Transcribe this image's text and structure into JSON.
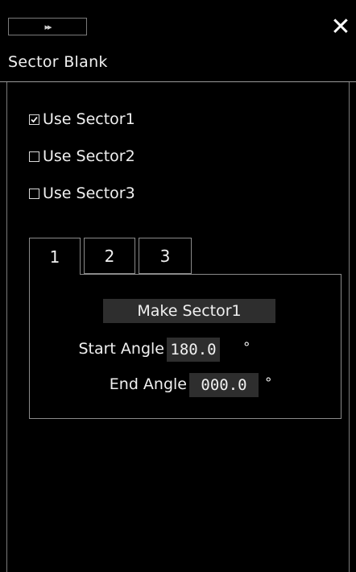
{
  "titlebar": {
    "expand_glyph": "▸▸",
    "close_glyph": "✕"
  },
  "header": {
    "title": "Sector Blank"
  },
  "sectors": [
    {
      "label": "Use Sector1",
      "checked": true
    },
    {
      "label": "Use Sector2",
      "checked": false
    },
    {
      "label": "Use Sector3",
      "checked": false
    }
  ],
  "tabs": [
    {
      "label": "1"
    },
    {
      "label": "2"
    },
    {
      "label": "3"
    }
  ],
  "panel": {
    "make_button": "Make Sector1",
    "start_label": "Start Angle",
    "start_value": "180.0",
    "end_label": "End Angle",
    "end_value": "000.0",
    "unit": "°"
  }
}
